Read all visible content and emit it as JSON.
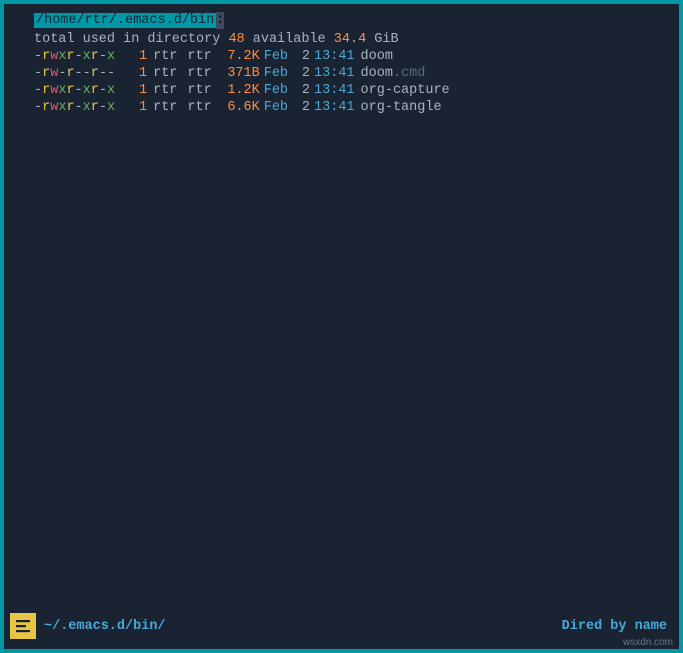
{
  "header": {
    "path": "/home/rtr/.emacs.d/bin",
    "path_suffix": ":"
  },
  "summary": {
    "prefix": "total used in directory ",
    "used": "48",
    "mid": " available ",
    "avail": "34.4",
    "suffix": " GiB"
  },
  "files": [
    {
      "perms": "-rwxr-xr-x",
      "links": "1",
      "owner": "rtr",
      "group": "rtr",
      "size": "7.2K",
      "month": "Feb",
      "day": "2",
      "time": "13:41",
      "name": "doom",
      "ext": ""
    },
    {
      "perms": "-rw-r--r--",
      "links": "1",
      "owner": "rtr",
      "group": "rtr",
      "size": "371B",
      "month": "Feb",
      "day": "2",
      "time": "13:41",
      "name": "doom",
      "ext": ".cmd"
    },
    {
      "perms": "-rwxr-xr-x",
      "links": "1",
      "owner": "rtr",
      "group": "rtr",
      "size": "1.2K",
      "month": "Feb",
      "day": "2",
      "time": "13:41",
      "name": "org-capture",
      "ext": ""
    },
    {
      "perms": "-rwxr-xr-x",
      "links": "1",
      "owner": "rtr",
      "group": "rtr",
      "size": "6.6K",
      "month": "Feb",
      "day": "2",
      "time": "13:41",
      "name": "org-tangle",
      "ext": ""
    }
  ],
  "modeline": {
    "path": "~/.emacs.d/bin/",
    "mode": "Dired by name"
  },
  "watermark": "wsxdn.com"
}
